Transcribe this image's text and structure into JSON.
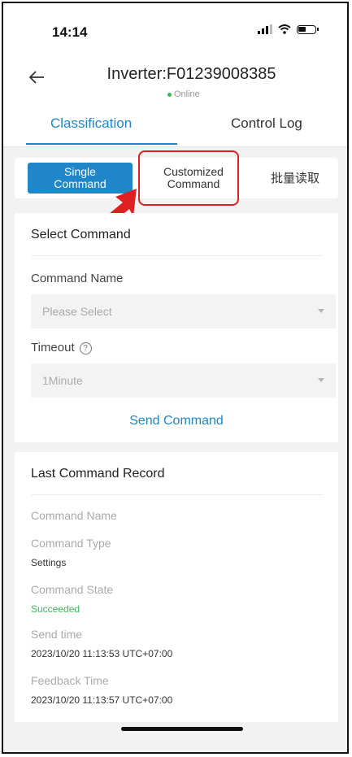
{
  "status_bar": {
    "time": "14:14",
    "icons": [
      "signal-icon",
      "wifi-icon",
      "battery-icon"
    ]
  },
  "header": {
    "title": "Inverter:F01239008385",
    "status": "Online"
  },
  "tabs": [
    {
      "label": "Classification",
      "active": true
    },
    {
      "label": "Control Log",
      "active": false
    }
  ],
  "segments": {
    "single_line1": "Single",
    "single_line2": "Command",
    "custom_line1": "Customized",
    "custom_line2": "Command",
    "batch": "批量读取"
  },
  "select_command": {
    "title": "Select Command",
    "command_name_label": "Command Name",
    "command_name_value": "Please Select",
    "timeout_label": "Timeout",
    "timeout_value": "1Minute",
    "send_button": "Send Command"
  },
  "last_record": {
    "title": "Last Command Record",
    "command_name_label": "Command Name",
    "command_type_label": "Command Type",
    "command_type_value": "Settings",
    "command_state_label": "Command State",
    "command_state_value": "Succeeded",
    "send_time_label": "Send time",
    "send_time_value": "2023/10/20 11:13:53 UTC+07:00",
    "feedback_time_label": "Feedback Time",
    "feedback_time_value": "2023/10/20 11:13:57 UTC+07:00"
  },
  "colors": {
    "accent": "#1e86c9",
    "success": "#3cb85a",
    "highlight": "#e02020"
  }
}
